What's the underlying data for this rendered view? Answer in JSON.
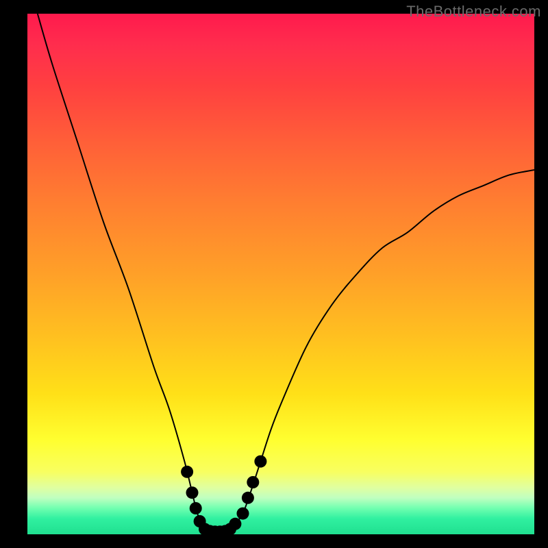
{
  "watermark": "TheBottleneck.com",
  "colors": {
    "frame": "#000000",
    "curve": "#000000",
    "dots": "#e58080",
    "gradient_top": "#ff1a4d",
    "gradient_bottom": "#20e090"
  },
  "chart_data": {
    "type": "line",
    "title": "",
    "xlabel": "",
    "ylabel": "",
    "xlim": [
      0,
      100
    ],
    "ylim": [
      0,
      100
    ],
    "grid": false,
    "series": [
      {
        "name": "bottleneck-curve",
        "x": [
          2,
          5,
          10,
          15,
          20,
          25,
          28,
          31,
          33,
          34.2,
          35,
          36,
          37,
          38,
          39,
          40,
          41,
          42.5,
          44,
          46,
          48,
          50,
          55,
          60,
          65,
          70,
          75,
          80,
          85,
          90,
          95,
          100
        ],
        "y": [
          100,
          90,
          75,
          60,
          47,
          32,
          24,
          14,
          6,
          2,
          1,
          0.5,
          0.5,
          0.5,
          0.5,
          1,
          2,
          4,
          8,
          14,
          20,
          25,
          36,
          44,
          50,
          55,
          58,
          62,
          65,
          67,
          69,
          70
        ]
      }
    ],
    "annotations": [],
    "dots": [
      {
        "x": 31.5,
        "y": 12
      },
      {
        "x": 32.5,
        "y": 8
      },
      {
        "x": 33.2,
        "y": 5
      },
      {
        "x": 34.0,
        "y": 2.5
      },
      {
        "x": 35.0,
        "y": 1
      },
      {
        "x": 36.0,
        "y": 0.6
      },
      {
        "x": 37.0,
        "y": 0.5
      },
      {
        "x": 38.0,
        "y": 0.5
      },
      {
        "x": 39.0,
        "y": 0.6
      },
      {
        "x": 40.0,
        "y": 1
      },
      {
        "x": 41.0,
        "y": 2
      },
      {
        "x": 42.5,
        "y": 4
      },
      {
        "x": 43.5,
        "y": 7
      },
      {
        "x": 44.5,
        "y": 10
      },
      {
        "x": 46.0,
        "y": 14
      }
    ]
  }
}
